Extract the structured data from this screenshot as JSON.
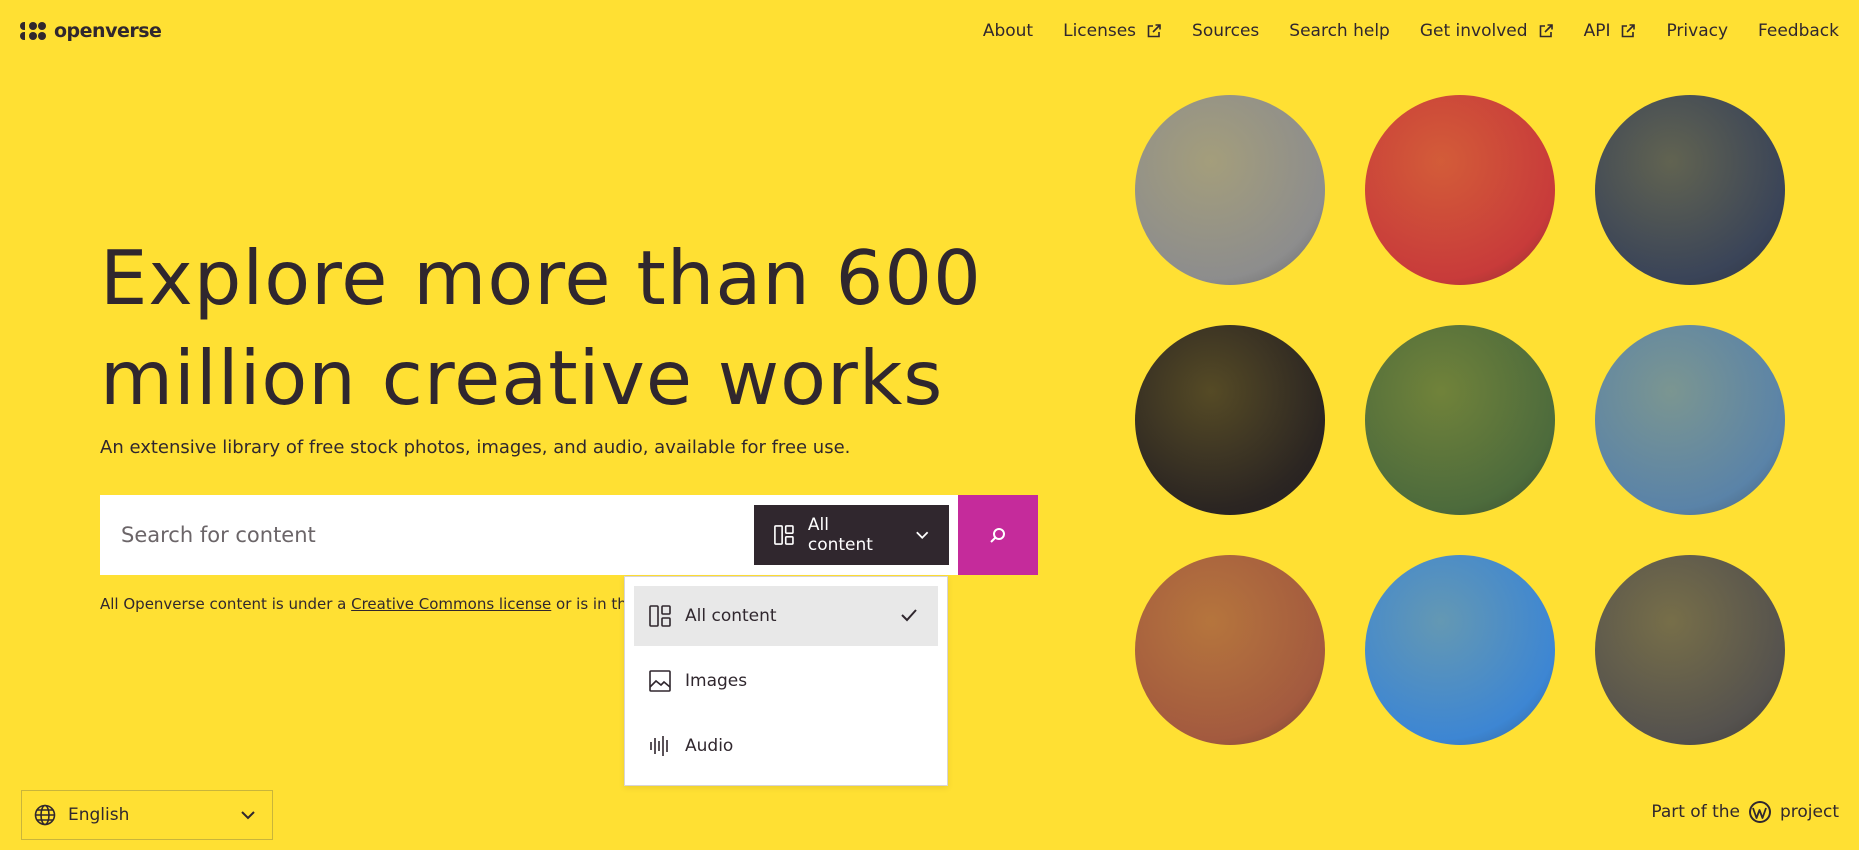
{
  "brand": {
    "name": "openverse"
  },
  "nav": {
    "items": [
      {
        "label": "About",
        "external": false
      },
      {
        "label": "Licenses",
        "external": true
      },
      {
        "label": "Sources",
        "external": false
      },
      {
        "label": "Search help",
        "external": false
      },
      {
        "label": "Get involved",
        "external": true
      },
      {
        "label": "API",
        "external": true
      },
      {
        "label": "Privacy",
        "external": false
      },
      {
        "label": "Feedback",
        "external": false
      }
    ]
  },
  "hero": {
    "headline_line1": "Explore more than 600",
    "headline_line2": "million creative works",
    "subheading": "An extensive library of free stock photos, images, and audio, available for free use."
  },
  "search": {
    "placeholder": "Search for content",
    "content_type_label": "All content",
    "submit_icon": "search-icon"
  },
  "license_note": {
    "prefix": "All Openverse content is under a ",
    "link": "Creative Commons license",
    "suffix": " or is in the pu"
  },
  "dropdown": {
    "options": [
      {
        "label": "All content",
        "icon": "all-content-icon",
        "selected": true
      },
      {
        "label": "Images",
        "icon": "image-icon",
        "selected": false
      },
      {
        "label": "Audio",
        "icon": "audio-icon",
        "selected": false
      }
    ]
  },
  "gallery": {
    "items": [
      {
        "name": "runner-portrait",
        "color": "#8d8d8d"
      },
      {
        "name": "red-shirt-athlete",
        "color": "#c83b3a"
      },
      {
        "name": "gymnast-hands",
        "color": "#3a4458"
      },
      {
        "name": "etching-figure",
        "color": "#2b2522"
      },
      {
        "name": "track-cyclist",
        "color": "#4d6b3c"
      },
      {
        "name": "painted-athlete",
        "color": "#5a83a8"
      },
      {
        "name": "helmet-cyclist",
        "color": "#a35a3f"
      },
      {
        "name": "hurdle-runner",
        "color": "#3d86d3"
      },
      {
        "name": "three-women",
        "color": "#55524e"
      }
    ]
  },
  "footer": {
    "language": "English",
    "wp_prefix": "Part of the",
    "wp_suffix": "project"
  },
  "colors": {
    "background": "#ffe033",
    "text": "#30272e",
    "accent": "#c52b9b",
    "dark_button": "#30272e"
  }
}
